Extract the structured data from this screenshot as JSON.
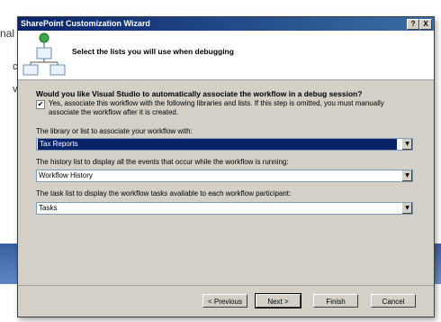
{
  "background": {
    "fragment_top": "nal",
    "fragment_mid": "c",
    "fragment_low": "v"
  },
  "dialog": {
    "title": "SharePoint Customization Wizard",
    "help_label": "?",
    "close_label": "X",
    "header_title": "Select the lists you will use when debugging",
    "question": "Would you like Visual Studio to automatically associate the workflow in a debug session?",
    "associate_checked": true,
    "check_mark": "✔",
    "associate_label": "Yes, associate this workflow with the following libraries and lists. If this step is omitted, you must manually associate the workflow after it is created.",
    "library_label": "The library or list to associate your workflow with:",
    "library_value": "Tax Reports",
    "history_label": "The history list to display all the events that occur while the workflow is running:",
    "history_value": "Workflow History",
    "task_label": "The task list to display the workflow tasks available to each workflow participant:",
    "task_value": "Tasks",
    "buttons": {
      "previous": "< Previous",
      "next": "Next >",
      "finish": "Finish",
      "cancel": "Cancel"
    }
  },
  "colors": {
    "titlebar_start": "#0a246a",
    "titlebar_end": "#3a6ea5",
    "dialog_bg": "#d4d0c8",
    "selection": "#0a246a"
  },
  "icons": [
    "workflow-icon",
    "help-icon",
    "close-icon",
    "dropdown-arrow-icon",
    "checkbox-icon"
  ]
}
